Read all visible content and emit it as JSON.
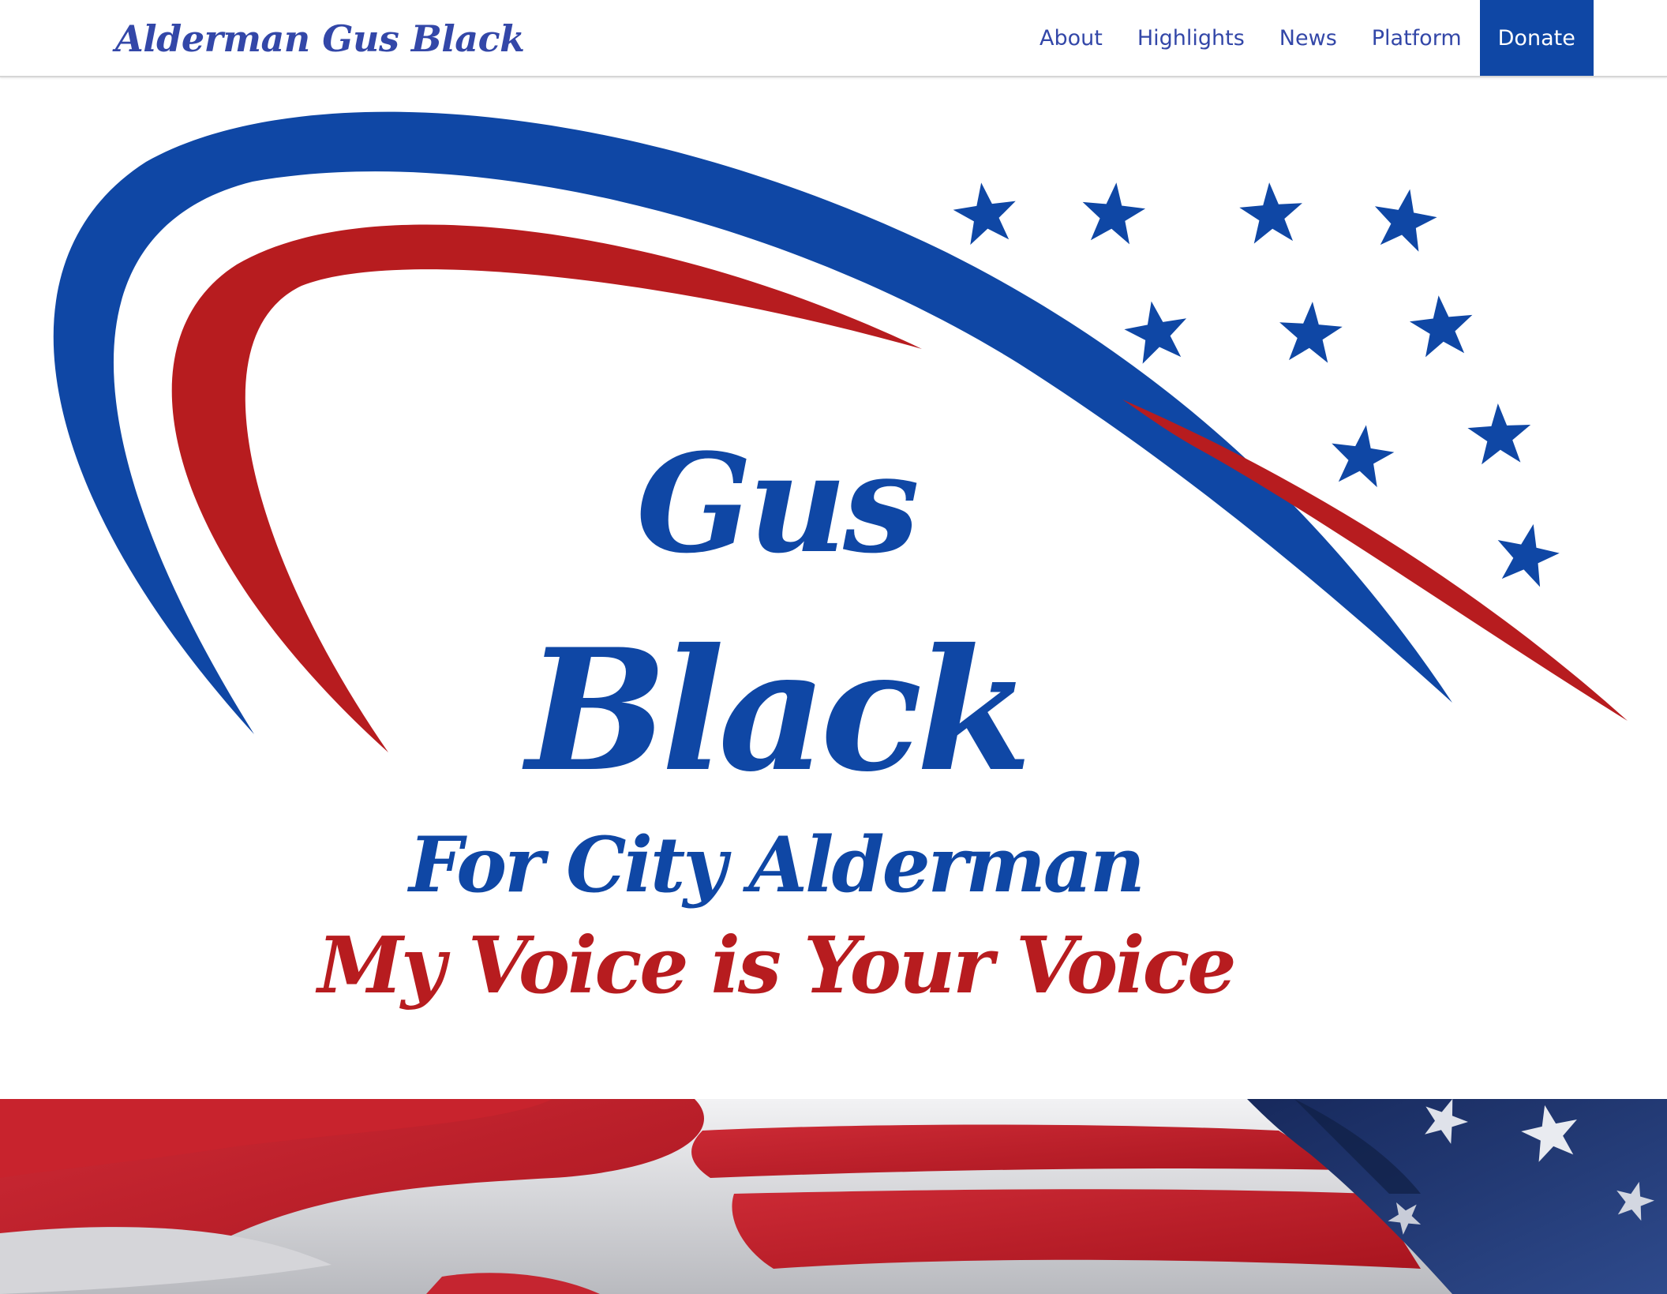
{
  "header": {
    "brand": "Alderman Gus Black",
    "nav": [
      {
        "label": "About"
      },
      {
        "label": "Highlights"
      },
      {
        "label": "News"
      },
      {
        "label": "Platform"
      },
      {
        "label": "Donate"
      }
    ]
  },
  "hero": {
    "first_name": "Gus",
    "last_name": "Black",
    "office": "For City Alderman",
    "slogan": "My Voice is Your Voice"
  },
  "colors": {
    "brand_blue": "#0f47a5",
    "nav_text": "#3347a8",
    "slogan_red": "#b71c1f"
  },
  "icons": {
    "stars": "star-icon",
    "swoosh": "swoosh-graphic",
    "flag": "american-flag-photo"
  }
}
